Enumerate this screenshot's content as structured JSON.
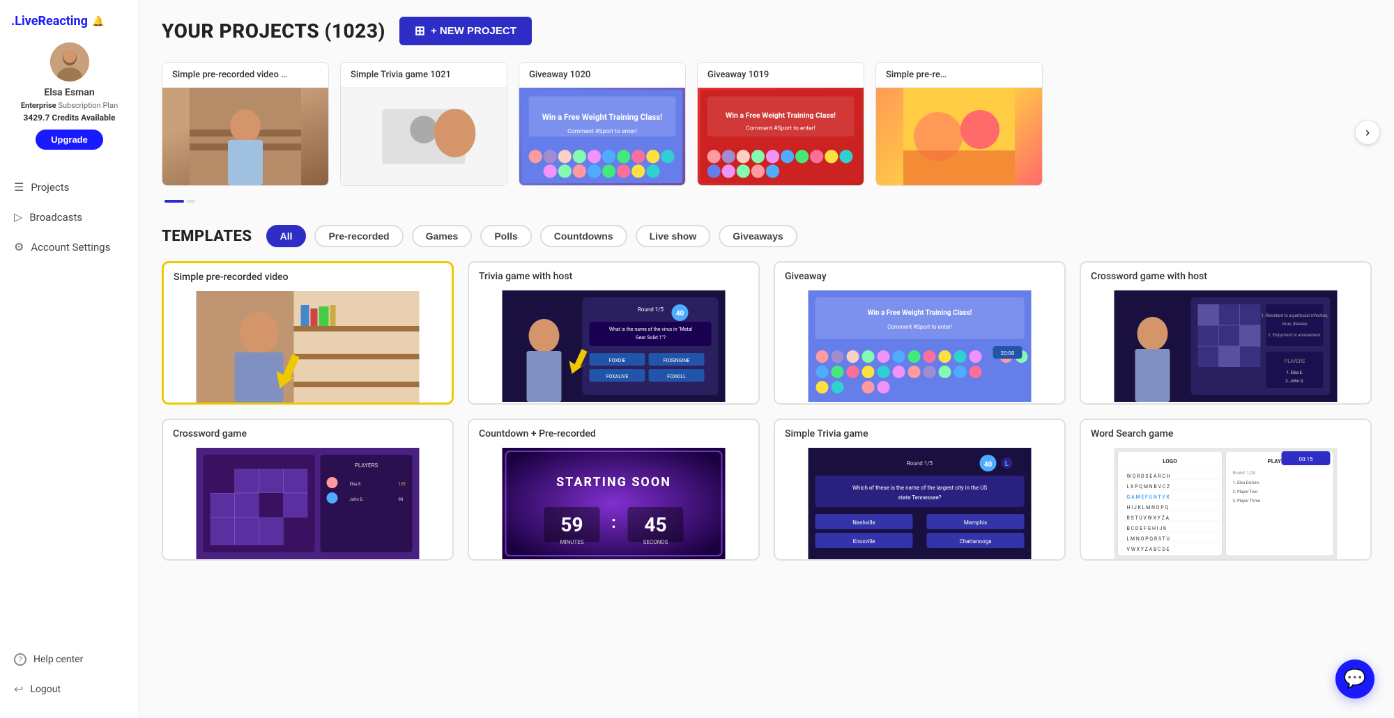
{
  "logo": {
    "text": ".LiveReacting",
    "bell_icon": "🔔"
  },
  "user": {
    "name": "Elsa Esman",
    "plan_label": "Enterprise",
    "plan_suffix": " Subscription Plan",
    "credits": "3429.7 Credits Available",
    "upgrade_label": "Upgrade",
    "avatar_emoji": "👩"
  },
  "nav": {
    "items": [
      {
        "label": "Projects",
        "icon": "☰"
      },
      {
        "label": "Broadcasts",
        "icon": "▷"
      },
      {
        "label": "Account Settings",
        "icon": "⚙"
      }
    ],
    "bottom": [
      {
        "label": "Help center",
        "icon": "?"
      },
      {
        "label": "Logout",
        "icon": "↩"
      }
    ]
  },
  "page": {
    "title": "YOUR PROJECTS (1023)",
    "new_project_label": "+ NEW PROJECT"
  },
  "projects": [
    {
      "title": "Simple pre-recorded video …",
      "thumb_type": "person"
    },
    {
      "title": "Simple Trivia game 1021",
      "thumb_type": "trivia"
    },
    {
      "title": "Giveaway 1020",
      "thumb_type": "giveaway"
    },
    {
      "title": "Giveaway 1019",
      "thumb_type": "giveaway_red"
    },
    {
      "title": "Simple pre-re…",
      "thumb_type": "fruit"
    }
  ],
  "templates_section": {
    "title": "TEMPLATES",
    "filters": [
      {
        "label": "All",
        "active": true
      },
      {
        "label": "Pre-recorded",
        "active": false
      },
      {
        "label": "Games",
        "active": false
      },
      {
        "label": "Polls",
        "active": false
      },
      {
        "label": "Countdowns",
        "active": false
      },
      {
        "label": "Live show",
        "active": false
      },
      {
        "label": "Giveaways",
        "active": false
      }
    ]
  },
  "templates": [
    {
      "title": "Simple pre-recorded video",
      "selected": true,
      "thumb_type": "prerecorded"
    },
    {
      "title": "Trivia game with host",
      "selected": false,
      "thumb_type": "trivia"
    },
    {
      "title": "Giveaway",
      "selected": false,
      "thumb_type": "giveaway"
    },
    {
      "title": "Crossword game with host",
      "selected": false,
      "thumb_type": "crossword"
    },
    {
      "title": "Crossword game",
      "selected": false,
      "thumb_type": "crossword_game"
    },
    {
      "title": "Countdown + Pre-recorded",
      "selected": false,
      "thumb_type": "countdown"
    },
    {
      "title": "Simple Trivia game",
      "selected": false,
      "thumb_type": "simple_trivia"
    },
    {
      "title": "Word Search game",
      "selected": false,
      "thumb_type": "word_search"
    }
  ]
}
